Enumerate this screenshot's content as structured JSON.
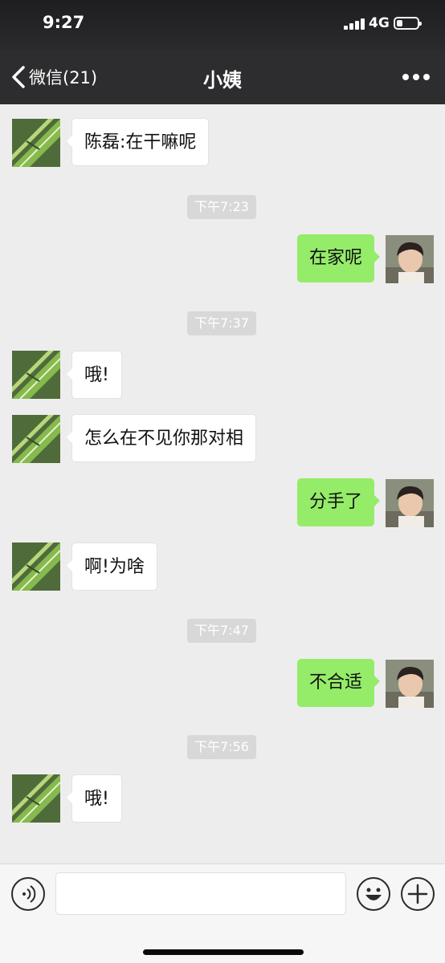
{
  "status_bar": {
    "time": "9:27",
    "network": "4G",
    "battery_level": 0.3
  },
  "nav": {
    "back_label": "微信(21)",
    "title": "小姨",
    "more_icon": "more-dots-icon"
  },
  "messages": [
    {
      "side": "left",
      "text": "陈磊:在干嘛呢"
    },
    {
      "time": "下午7:23"
    },
    {
      "side": "right",
      "text": "在家呢"
    },
    {
      "time": "下午7:37"
    },
    {
      "side": "left",
      "text": "哦!"
    },
    {
      "side": "left",
      "text": "怎么在不见你那对相"
    },
    {
      "side": "right",
      "text": "分手了"
    },
    {
      "side": "left",
      "text": "啊!为啥"
    },
    {
      "time": "下午7:47"
    },
    {
      "side": "right",
      "text": "不合适"
    },
    {
      "time": "下午7:56"
    },
    {
      "side": "left",
      "text": "哦!"
    }
  ],
  "input_bar": {
    "voice_icon": "voice-icon",
    "input_value": "",
    "emoji_icon": "emoji-icon",
    "add_icon": "plus-icon"
  },
  "colors": {
    "background": "#ededed",
    "nav_background": "#2d2d2f",
    "outgoing_bubble": "#95ec69",
    "incoming_bubble": "#ffffff",
    "time_pill": "#d8d8d8"
  }
}
